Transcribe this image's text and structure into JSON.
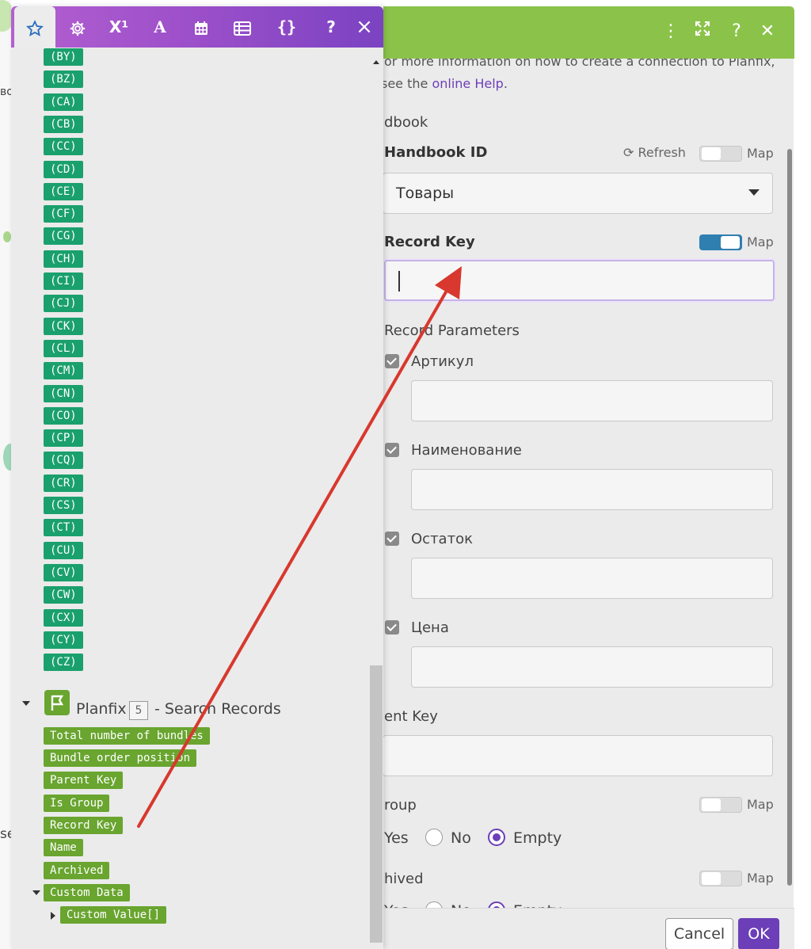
{
  "background": {
    "left_text_1": "во",
    "left_text_2": "se"
  },
  "dialog": {
    "intro_line_1": "or more information on how to create a connection to Planfix,",
    "intro_line_2_prefix": "see the ",
    "intro_line_2_link": "online Help",
    "intro_line_2_suffix": ".",
    "handbook_section": "dbook",
    "handbook_id_label": "Handbook ID",
    "refresh_label": "Refresh",
    "map_label": "Map",
    "handbook_id_value": "Товары",
    "record_key_label": "Record Key",
    "record_params_label": "Record Parameters",
    "params": [
      {
        "label": "Артикул"
      },
      {
        "label": "Наименование"
      },
      {
        "label": "Остаток"
      },
      {
        "label": "Цена"
      }
    ],
    "parent_key_label": "ent Key",
    "group_label": "roup",
    "archived_label": "hived",
    "yes_label": "Yes",
    "no_label": "No",
    "empty_label": "Empty",
    "cancel_label": "Cancel",
    "ok_label": "OK"
  },
  "panel": {
    "tabs": [
      "star",
      "gear",
      "X¹",
      "A",
      "calendar",
      "table",
      "{}",
      "?"
    ],
    "tab_superscript": "X¹",
    "tab_text": "A",
    "tab_braces": "{}",
    "tab_help": "?",
    "close_label": "×",
    "codes": [
      "(BY)",
      "(BZ)",
      "(CA)",
      "(CB)",
      "(CC)",
      "(CD)",
      "(CE)",
      "(CF)",
      "(CG)",
      "(CH)",
      "(CI)",
      "(CJ)",
      "(CK)",
      "(CL)",
      "(CM)",
      "(CN)",
      "(CO)",
      "(CP)",
      "(CQ)",
      "(CR)",
      "(CS)",
      "(CT)",
      "(CU)",
      "(CV)",
      "(CW)",
      "(CX)",
      "(CY)",
      "(CZ)"
    ],
    "module_name": "Planfix",
    "module_number": "5",
    "module_title": "- Search Records",
    "fields": [
      "Total number of bundles",
      "Bundle order position",
      "Parent Key",
      "Is Group",
      "Record Key",
      "Name",
      "Archived",
      "Custom Data"
    ],
    "subfield": "Custom Value[]"
  },
  "colors": {
    "header_green": "#8bc34a",
    "tab_purple": "#9b4fc9",
    "chip_teal": "#1aa06d",
    "chip_green": "#69a52f",
    "accent_purple": "#6c3fb8",
    "arrow_red": "#d8382e"
  }
}
